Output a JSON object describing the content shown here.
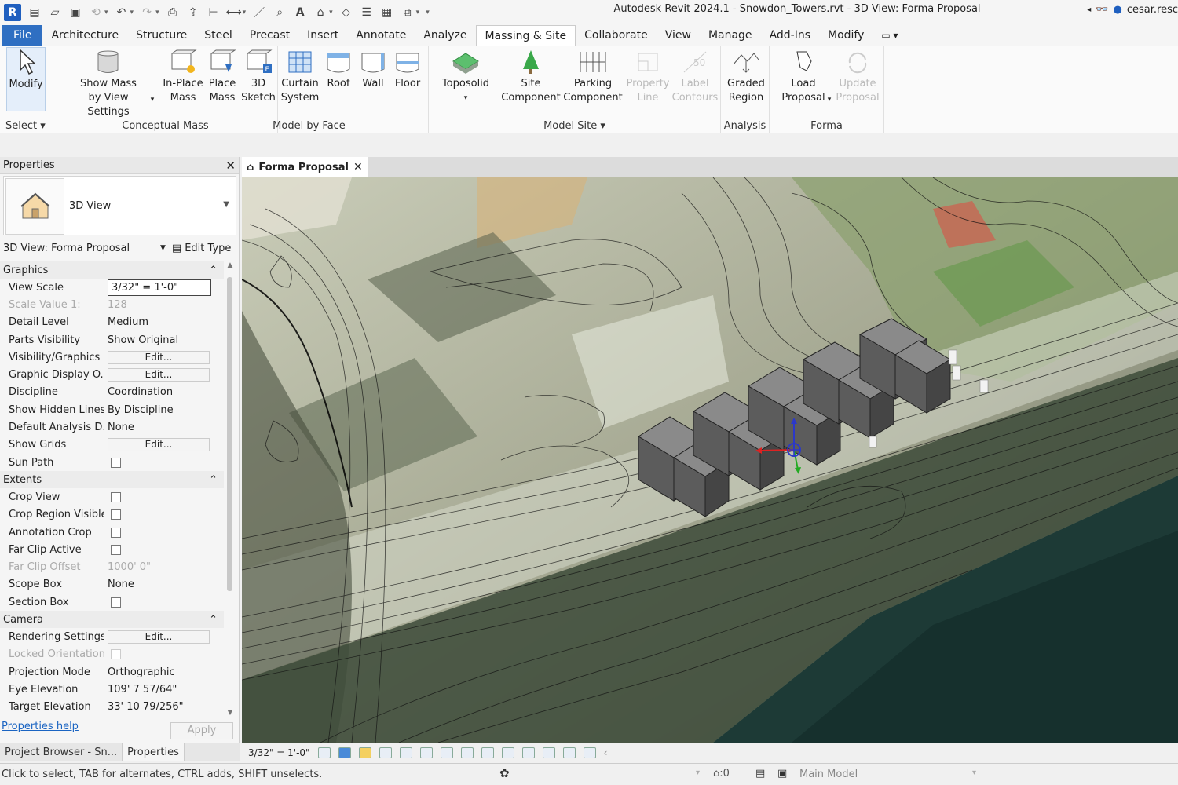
{
  "title": "Autodesk Revit 2024.1 - Snowdon_Towers.rvt - 3D View: Forma Proposal",
  "user": "cesar.resc",
  "tabs": [
    "File",
    "Architecture",
    "Structure",
    "Steel",
    "Precast",
    "Insert",
    "Annotate",
    "Analyze",
    "Massing & Site",
    "Collaborate",
    "View",
    "Manage",
    "Add-Ins",
    "Modify"
  ],
  "active_tab": "Massing & Site",
  "ribbon": {
    "select": {
      "modify": "Modify",
      "title": "Select"
    },
    "conceptual_mass": {
      "show_mass_1": "Show Mass",
      "show_mass_2": "by View Settings",
      "inplace_1": "In-Place",
      "inplace_2": "Mass",
      "place_1": "Place",
      "place_2": "Mass",
      "title": "Conceptual Mass"
    },
    "model_by_face": {
      "sketch_1": "3D",
      "sketch_2": "Sketch",
      "curtain_1": "Curtain",
      "curtain_2": "System",
      "roof": "Roof",
      "wall": "Wall",
      "floor": "Floor",
      "title": "Model by Face"
    },
    "model_site": {
      "toposolid": "Toposolid",
      "site_1": "Site",
      "site_2": "Component",
      "parking_1": "Parking",
      "parking_2": "Component",
      "property_1": "Property",
      "property_2": "Line",
      "label_1": "Label",
      "label_2": "Contours",
      "title": "Model Site"
    },
    "analysis": {
      "graded_1": "Graded",
      "graded_2": "Region",
      "title": "Analysis"
    },
    "forma": {
      "load_1": "Load",
      "load_2": "Proposal",
      "update_1": "Update",
      "update_2": "Proposal",
      "title": "Forma"
    }
  },
  "properties": {
    "header": "Properties",
    "type_name": "3D View",
    "instance": "3D View: Forma Proposal",
    "edit_type": "Edit Type",
    "groups": [
      {
        "name": "Graphics",
        "rows": [
          {
            "k": "View Scale",
            "v": "3/32\" = 1'-0\"",
            "kind": "input"
          },
          {
            "k": "Scale Value    1:",
            "v": "128",
            "kind": "dim"
          },
          {
            "k": "Detail Level",
            "v": "Medium"
          },
          {
            "k": "Parts Visibility",
            "v": "Show Original"
          },
          {
            "k": "Visibility/Graphics ...",
            "v": "Edit...",
            "kind": "btn"
          },
          {
            "k": "Graphic Display O...",
            "v": "Edit...",
            "kind": "btn"
          },
          {
            "k": "Discipline",
            "v": "Coordination"
          },
          {
            "k": "Show Hidden Lines",
            "v": "By Discipline"
          },
          {
            "k": "Default Analysis D...",
            "v": "None"
          },
          {
            "k": "Show Grids",
            "v": "Edit...",
            "kind": "btn"
          },
          {
            "k": "Sun Path",
            "v": "",
            "kind": "chk"
          }
        ]
      },
      {
        "name": "Extents",
        "rows": [
          {
            "k": "Crop View",
            "v": "",
            "kind": "chk"
          },
          {
            "k": "Crop Region Visible",
            "v": "",
            "kind": "chk"
          },
          {
            "k": "Annotation Crop",
            "v": "",
            "kind": "chk"
          },
          {
            "k": "Far Clip Active",
            "v": "",
            "kind": "chk"
          },
          {
            "k": "Far Clip Offset",
            "v": "1000'  0\"",
            "kind": "dim"
          },
          {
            "k": "Scope Box",
            "v": "None"
          },
          {
            "k": "Section Box",
            "v": "",
            "kind": "chk"
          }
        ]
      },
      {
        "name": "Camera",
        "rows": [
          {
            "k": "Rendering Settings",
            "v": "Edit...",
            "kind": "btn"
          },
          {
            "k": "Locked Orientation",
            "v": "",
            "kind": "chkdim"
          },
          {
            "k": "Projection Mode",
            "v": "Orthographic"
          },
          {
            "k": "Eye Elevation",
            "v": "109'  7 57/64\""
          },
          {
            "k": "Target Elevation",
            "v": "33'  10 79/256\""
          }
        ]
      }
    ],
    "help": "Properties help",
    "apply": "Apply"
  },
  "browser_tabs": [
    "Project Browser - Sn...",
    "Properties"
  ],
  "view": {
    "tab": "Forma Proposal",
    "scale": "3/32\" = 1'-0\""
  },
  "status": {
    "text": "Click to select, TAB for alternates, CTRL adds, SHIFT unselects.",
    "model": "Main Model",
    "count": ":0"
  },
  "colors": {
    "accent": "#2f6fc2",
    "water": "#1d3a36",
    "building": "#6b6b6b"
  }
}
